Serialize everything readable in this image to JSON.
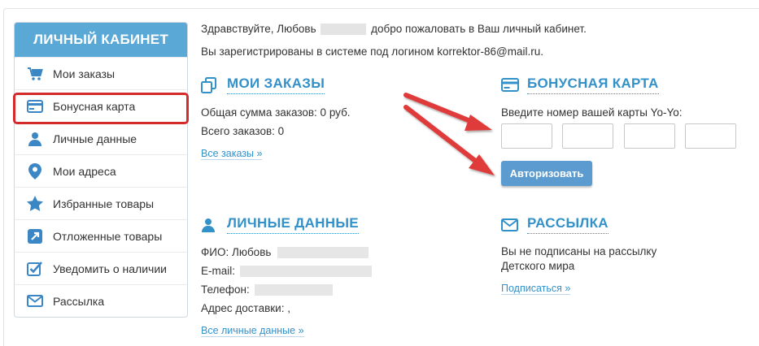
{
  "sidebar": {
    "title": "ЛИЧНЫЙ КАБИНЕТ",
    "items": [
      {
        "label": "Мои заказы",
        "icon": "cart-icon"
      },
      {
        "label": "Бонусная карта",
        "icon": "card-icon"
      },
      {
        "label": "Личные данные",
        "icon": "user-icon"
      },
      {
        "label": "Мои адреса",
        "icon": "map-pin-icon"
      },
      {
        "label": "Избранные товары",
        "icon": "star-icon"
      },
      {
        "label": "Отложенные товары",
        "icon": "arrow-box-icon"
      },
      {
        "label": "Уведомить о наличии",
        "icon": "checkbox-icon"
      },
      {
        "label": "Рассылка",
        "icon": "envelope-icon"
      }
    ]
  },
  "greeting": {
    "hello": "Здравствуйте, Любовь",
    "welcome": "добро пожаловать в Ваш личный кабинет.",
    "login_line": "Вы зарегистрированы в системе под логином korrektor-86@mail.ru."
  },
  "orders": {
    "title": "МОИ ЗАКАЗЫ",
    "total_sum": "Общая сумма заказов: 0 руб.",
    "total_count": "Всего заказов: 0",
    "all_link": "Все заказы »"
  },
  "bonus": {
    "title": "БОНУСНАЯ КАРТА",
    "prompt": "Введите номер вашей карты Yo-Yo:",
    "button": "Авторизовать"
  },
  "personal": {
    "title": "ЛИЧНЫЕ ДАННЫЕ",
    "fio_label": "ФИО: Любовь",
    "email_label": "E-mail:",
    "phone_label": "Телефон:",
    "address_label": "Адрес доставки: ,",
    "all_link": "Все личные данные »"
  },
  "newsletter": {
    "title": "РАССЫЛКА",
    "line1": "Вы не подписаны на рассылку",
    "line2": "Детского мира",
    "subscribe_link": "Подписаться »"
  },
  "colors": {
    "accent": "#3391c9",
    "header_bg": "#5aa8d6",
    "button_bg": "#5c9bcf",
    "highlight": "#d42a2a",
    "arrow": "#e03a3a"
  }
}
